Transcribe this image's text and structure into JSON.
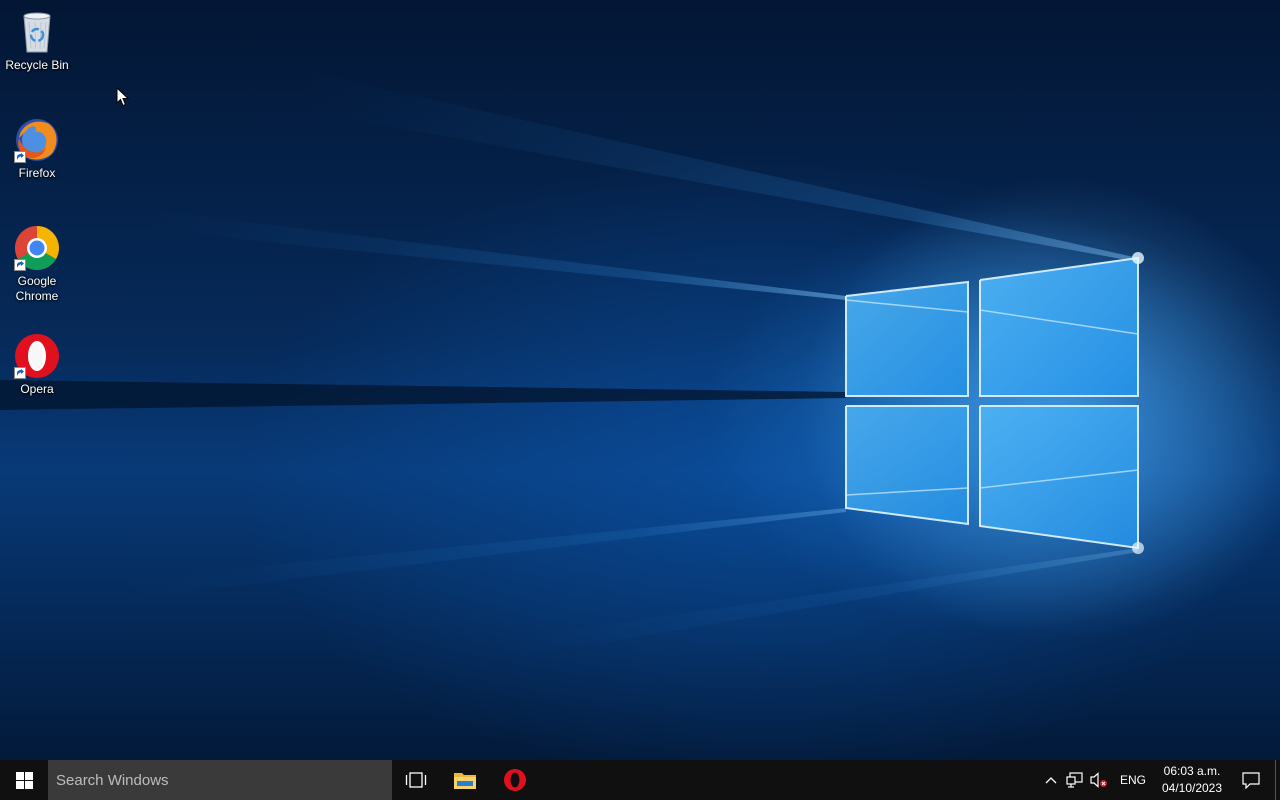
{
  "desktop": {
    "icons": [
      {
        "label": "Recycle Bin",
        "icon": "recycle-bin-icon"
      },
      {
        "label": "Firefox",
        "icon": "firefox-icon"
      },
      {
        "label": "Google Chrome",
        "icon": "chrome-icon"
      },
      {
        "label": "Opera",
        "icon": "opera-icon"
      }
    ]
  },
  "taskbar": {
    "start_icon": "windows-logo-icon",
    "search": {
      "placeholder": "Search Windows",
      "value": ""
    },
    "pinned": [
      {
        "name": "Task View",
        "icon": "task-view-icon"
      },
      {
        "name": "File Explorer",
        "icon": "file-explorer-icon"
      },
      {
        "name": "Opera",
        "icon": "opera-icon"
      }
    ],
    "tray": {
      "language": "ENG",
      "time": "06:03 a.m.",
      "date": "04/10/2023",
      "icons": [
        "chevron-up-icon",
        "network-icon",
        "volume-muted-icon",
        "notification-icon"
      ]
    }
  },
  "colors": {
    "accent": "#0078d7",
    "taskbar": "#101010",
    "search_box": "#3a3a3a",
    "opera_red": "#e0101e"
  }
}
